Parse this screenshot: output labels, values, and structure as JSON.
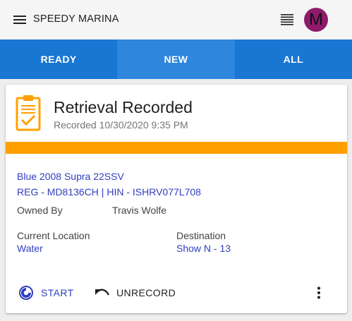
{
  "app": {
    "title": "SPEEDY MARINA",
    "avatar_letter": "M",
    "avatar_color": "#8e1a6b"
  },
  "tabs": [
    {
      "label": "READY",
      "active": false
    },
    {
      "label": "NEW",
      "active": true
    },
    {
      "label": "ALL",
      "active": false
    }
  ],
  "card": {
    "icon": "clipboard-check-icon",
    "title": "Retrieval Recorded",
    "subtitle": "Recorded 10/30/2020 9:35 PM",
    "status_color": "#ffa000",
    "boat_name": "Blue 2008 Supra 22SSV",
    "boat_ids": "REG - MD8136CH | HIN - ISHRV077L708",
    "owned_label": "Owned By",
    "owned_value": "Travis Wolfe",
    "location_label": "Current Location",
    "location_value": "Water",
    "destination_label": "Destination",
    "destination_value": "Show N - 13"
  },
  "actions": {
    "start_label": "START",
    "unrecord_label": "UNRECORD"
  },
  "colors": {
    "primary": "#1976d2",
    "active_tab": "#2f86dd",
    "link": "#2f3fbf",
    "warning": "#ffa000"
  }
}
